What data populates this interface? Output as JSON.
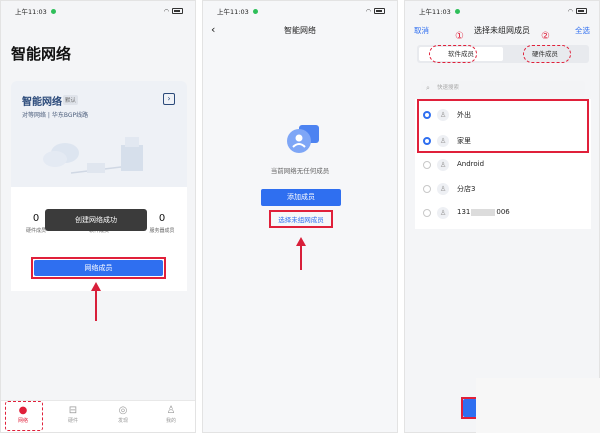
{
  "status": {
    "time": "上午11:03"
  },
  "p1": {
    "page_title": "智能网络",
    "card_name": "智能网络",
    "badge": "默认",
    "subtitle": "对等网络 | 华东BGP线路",
    "go_icon": "chevron-right-icon",
    "stats": [
      {
        "num": "0",
        "label": "硬件成员"
      },
      {
        "num": "0",
        "label": "软件成员"
      },
      {
        "num": "0",
        "label": "服务器成员"
      }
    ],
    "toast": "创建网络成功",
    "members_button": "网络成员",
    "tabs": [
      {
        "label": "网络",
        "icon": "network-icon"
      },
      {
        "label": "硬件",
        "icon": "router-icon"
      },
      {
        "label": "发现",
        "icon": "compass-icon"
      },
      {
        "label": "我的",
        "icon": "person-icon"
      }
    ]
  },
  "p2": {
    "title": "智能网络",
    "empty_text": "当前网络无任何成员",
    "add_button": "添加成员",
    "select_link": "选择未组网成员"
  },
  "p3": {
    "title": "选择未组网成员",
    "cancel": "取消",
    "select_all": "全选",
    "seg_software": "软件成员",
    "seg_hardware": "硬件成员",
    "marker_1": "①",
    "marker_2": "②",
    "search_placeholder": "快速搜索",
    "members": [
      {
        "name": "外出",
        "selected": true
      },
      {
        "name": "家里",
        "selected": true
      },
      {
        "name": "Android",
        "selected": false
      },
      {
        "name": "分店3",
        "selected": false
      },
      {
        "name_prefix": "131",
        "name_suffix": "006",
        "selected": false
      }
    ]
  },
  "colors": {
    "accent": "#2f6ff0",
    "highlight": "#e0203a"
  }
}
